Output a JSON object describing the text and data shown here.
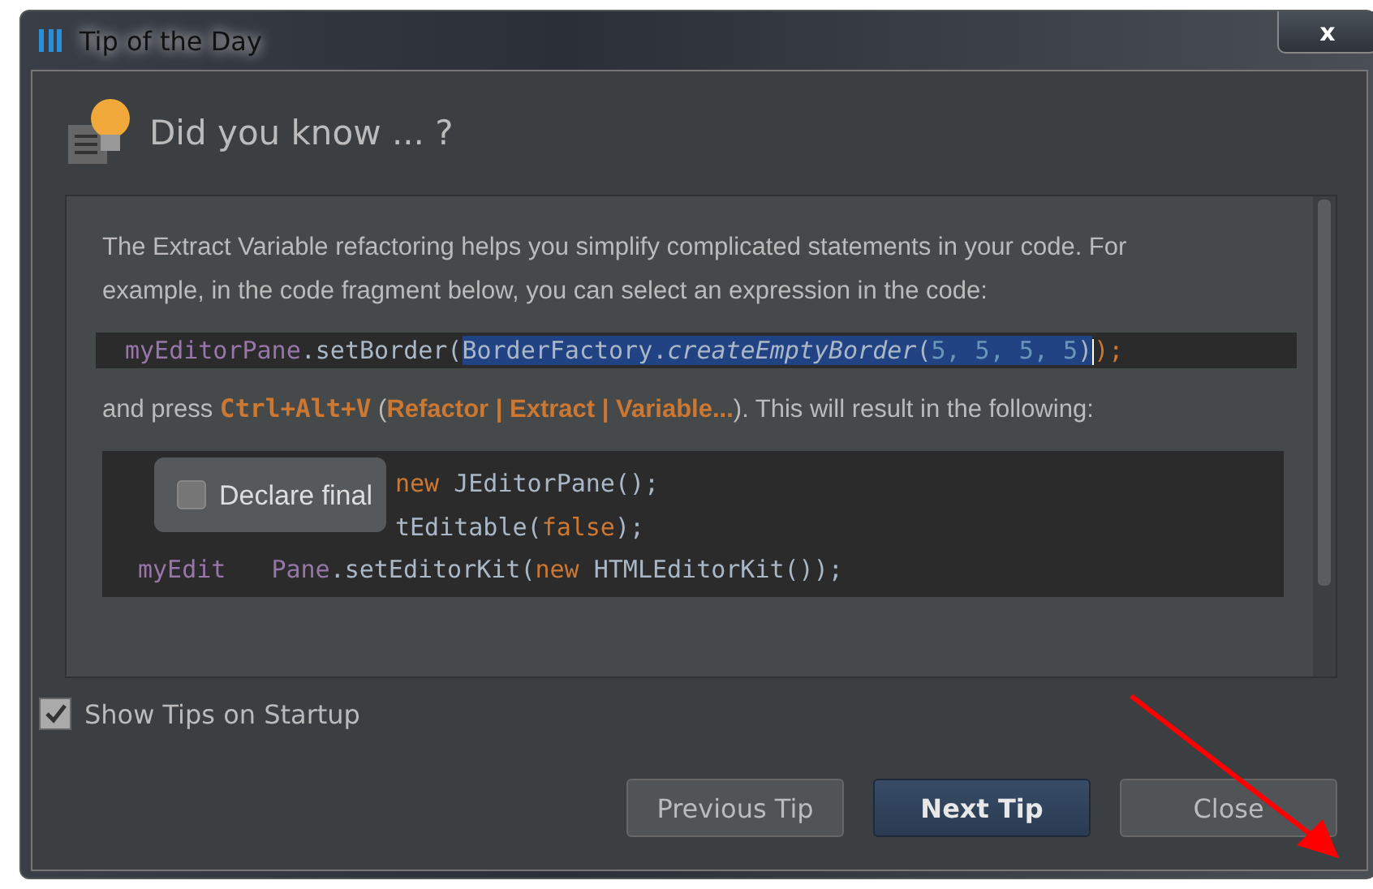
{
  "window": {
    "title": "Tip of the Day",
    "close_label": "x"
  },
  "header": "Did you know ... ?",
  "tip": {
    "intro": "The Extract Variable refactoring helps you simplify complicated statements in your code. For example, in the code fragment below, you can select an expression in the code:",
    "code_line": [
      {
        "text": "myEditorPane",
        "kind": "field",
        "selected": false
      },
      {
        "text": ".setBorder(",
        "kind": "plain",
        "selected": false
      },
      {
        "text": "BorderFactory.",
        "kind": "plain",
        "selected": true
      },
      {
        "text": "createEmptyBorder",
        "kind": "method",
        "selected": true
      },
      {
        "text": "(",
        "kind": "plain",
        "selected": true
      },
      {
        "text": "5, 5, 5, 5",
        "kind": "number",
        "selected": true
      },
      {
        "text": ")",
        "kind": "plain",
        "selected": true
      },
      {
        "text": ");",
        "kind": "keyword",
        "selected": false
      }
    ],
    "after": [
      {
        "text": "and press ",
        "kind": "plain"
      },
      {
        "text": "Ctrl+Alt+V",
        "kind": "shortcut"
      },
      {
        "text": " (",
        "kind": "plain"
      },
      {
        "text": "Refactor | Extract | Variable...",
        "kind": "menu"
      },
      {
        "text": "). This will result in the following:",
        "kind": "plain"
      }
    ],
    "result_lines": [
      [
        {
          "text": "new",
          "kind": "keyword"
        },
        {
          "text": " JEditorPane();",
          "kind": "plain"
        }
      ],
      [
        {
          "text": "tEditable(",
          "kind": "plain"
        },
        {
          "text": "false",
          "kind": "keyword"
        },
        {
          "text": ");",
          "kind": "plain"
        }
      ],
      [
        {
          "text": "myEdit",
          "kind": "field"
        },
        {
          "text": "Pane",
          "kind": "field"
        },
        {
          "text": ".setEditorKit(",
          "kind": "plain"
        },
        {
          "text": "new",
          "kind": "keyword"
        },
        {
          "text": " HTMLEditorKit());",
          "kind": "plain"
        }
      ]
    ],
    "popup": {
      "label": "Declare final",
      "checked": false
    }
  },
  "show_on_startup": {
    "label": "Show Tips on Startup",
    "checked": true
  },
  "buttons": [
    {
      "label": "Previous Tip",
      "kind": "normal"
    },
    {
      "label": "Next Tip",
      "kind": "default"
    },
    {
      "label": "Close",
      "kind": "normal"
    }
  ],
  "annotations": [
    {
      "kind": "arrow",
      "color": "#ff0000"
    }
  ]
}
